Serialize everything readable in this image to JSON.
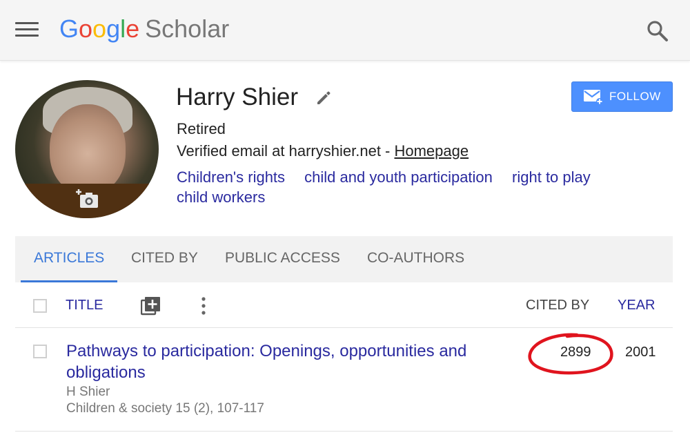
{
  "header": {
    "logo_letters": [
      "G",
      "o",
      "o",
      "g",
      "l",
      "e"
    ],
    "logo_suffix": "Scholar",
    "menu_icon": "hamburger-menu-icon",
    "search_icon": "search-icon"
  },
  "profile": {
    "name": "Harry Shier",
    "affiliation": "Retired",
    "email_text": "Verified email at harryshier.net - ",
    "homepage_label": "Homepage",
    "interests": [
      "Children's rights",
      "child and youth participation",
      "right to play",
      "child workers"
    ],
    "follow_label": "FOLLOW"
  },
  "tabs": [
    {
      "label": "ARTICLES",
      "active": true
    },
    {
      "label": "CITED BY",
      "active": false
    },
    {
      "label": "PUBLIC ACCESS",
      "active": false
    },
    {
      "label": "CO-AUTHORS",
      "active": false
    }
  ],
  "table": {
    "col_title": "TITLE",
    "col_cited_by": "CITED BY",
    "col_year": "YEAR",
    "rows": [
      {
        "title": "Pathways to participation: Openings, opportunities and obligations",
        "authors": "H Shier",
        "venue": "Children & society 15 (2), 107-117",
        "cited_by": "2899",
        "year": "2001"
      }
    ]
  },
  "colors": {
    "accent_blue": "#3a78d8",
    "link_blue": "#2a2a9f",
    "follow_button": "#4d90fe",
    "annotation_red": "#e0141e"
  }
}
